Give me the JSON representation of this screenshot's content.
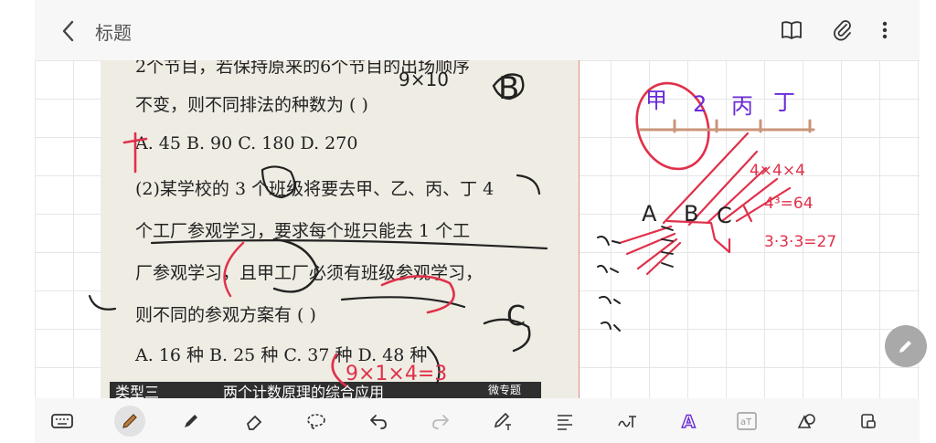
{
  "header": {
    "title": "标题"
  },
  "page": {
    "lines": [
      "2个节目，若保持原来的6个节目的出场顺序",
      "不变，则不同排法的种数为            (   )",
      "A. 45          B. 90          C. 180          D. 270",
      "(2)某学校的 3 个班级将要去甲、乙、丙、丁 4",
      "个工厂参观学习，要求每个班只能去 1 个工",
      "厂参观学习，且甲工厂必须有班级参观学习，",
      "则不同的参观方案有                       (   )",
      "A. 16 种      B. 25 种      C. 37 种      D. 48 种"
    ],
    "footer_tag": "类型三",
    "footer_text": "两个计数原理的综合应用",
    "footer_badge": "微专题"
  },
  "handwriting": {
    "answer1": "B",
    "answer2": "C",
    "note_a": "9×10",
    "note_b": "4×4×4",
    "note_c": "4³=64",
    "note_d": "3·3·3=27",
    "note_e": "9×1×4=3",
    "factories": [
      "甲",
      "2",
      "丙",
      "丁"
    ],
    "classes": [
      "A",
      "B",
      "C"
    ]
  },
  "colors": {
    "ink_red": "#e0304a",
    "ink_purple": "#6a2bd6",
    "ink_brown": "#c9957a",
    "accent": "#6a2bd6"
  },
  "toolbar_top": {
    "icons": [
      "back-icon",
      "book-icon",
      "attach-icon",
      "more-icon"
    ]
  },
  "toolbar_bottom": {
    "icons": [
      "keyboard-icon",
      "pen-icon",
      "highlighter-icon",
      "eraser-icon",
      "lasso-icon",
      "undo-icon",
      "redo-icon",
      "text-pen-icon",
      "text-format-icon",
      "handwriting-convert-icon",
      "ai-font-icon",
      "text-recognize-icon",
      "shapes-icon",
      "lock-icon"
    ]
  }
}
